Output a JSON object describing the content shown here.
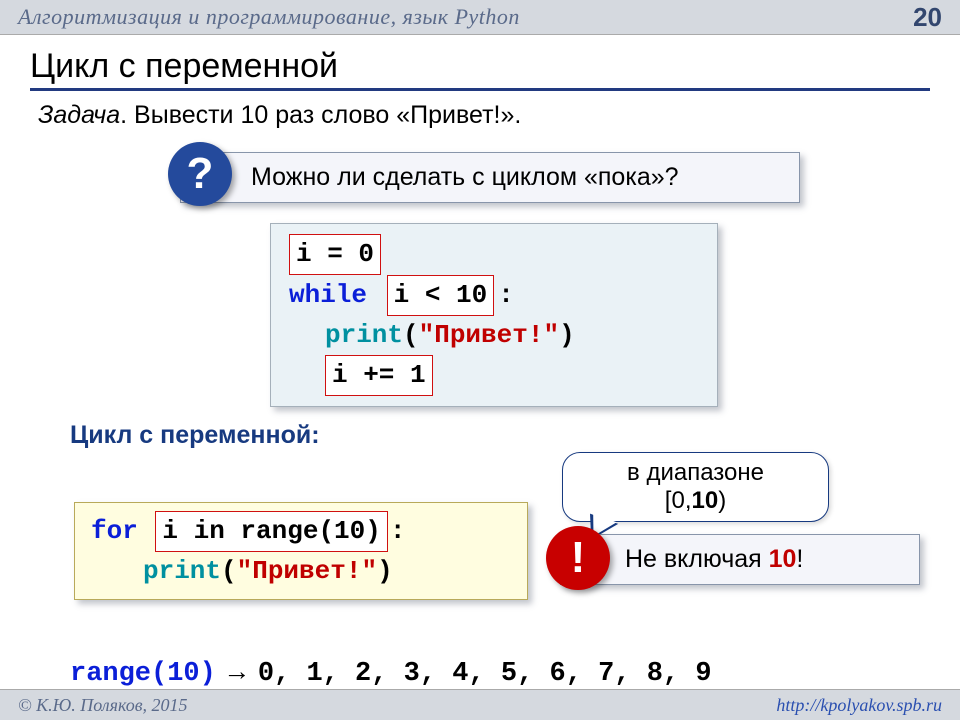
{
  "header": {
    "title": "Алгоритмизация и программирование, язык Python",
    "page": "20"
  },
  "slide_title": "Цикл с переменной",
  "task": {
    "label": "Задача",
    "text": ". Вывести 10 раз слово «Привет!»."
  },
  "q_callout": {
    "badge": "?",
    "text": "Можно ли сделать с циклом «пока»?"
  },
  "code1": {
    "l1": "i = 0",
    "while": "while",
    "cond": "i < 10",
    "colon1": ":",
    "print": "print",
    "paren_open": "(",
    "str": "\"Привет!\"",
    "paren_close": ")",
    "inc": "i += 1"
  },
  "subtitle": "Цикл с переменной:",
  "code2": {
    "for": "for",
    "rest": "i in range(10)",
    "colon": ":",
    "print": "print",
    "paren_open": "(",
    "str": "\"Привет!\"",
    "paren_close": ")"
  },
  "bubble_range": {
    "l1": "в диапазоне",
    "l2a": "[0,",
    "l2b": "10",
    "l2c": ")"
  },
  "exclaim_callout": {
    "badge": "!",
    "prefix": "Не включая ",
    "num": "10",
    "suffix": "!"
  },
  "range_line": {
    "range": "range(10)",
    "arrow": " → ",
    "vals": "0, 1, 2, 3, 4, 5, 6, 7, 8, 9"
  },
  "footer": {
    "left": "© К.Ю. Поляков, 2015",
    "right": "http://kpolyakov.spb.ru"
  }
}
